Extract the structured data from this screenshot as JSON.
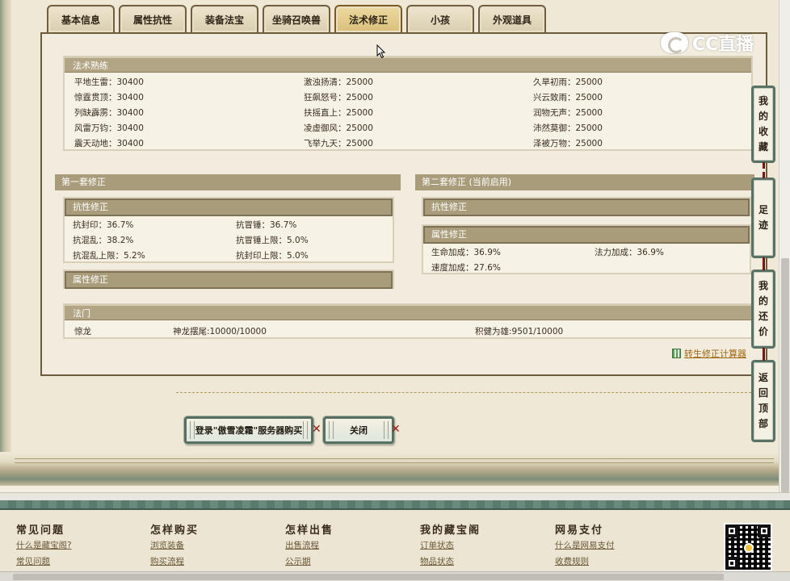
{
  "tabs": [
    {
      "label": "基本信息",
      "active": false
    },
    {
      "label": "属性抗性",
      "active": false
    },
    {
      "label": "装备法宝",
      "active": false
    },
    {
      "label": "坐骑召唤兽",
      "active": false
    },
    {
      "label": "法术修正",
      "active": true
    },
    {
      "label": "小孩",
      "active": false
    },
    {
      "label": "外观道具",
      "active": false
    }
  ],
  "skills": {
    "title": "法术熟练",
    "rows": [
      [
        "平地生雷：30400",
        "激浊扬清：25000",
        "久旱初雨：25000"
      ],
      [
        "惊霆贯顶：30400",
        "狂飙怒号：25000",
        "兴云致雨：25000"
      ],
      [
        "列缺霹雳：30400",
        "扶摇直上：25000",
        "润物无声：25000"
      ],
      [
        "风雷万钧：30400",
        "凌虚御风：25000",
        "沛然莫御：25000"
      ],
      [
        "震天动地：30400",
        "飞举九天：25000",
        "泽被万物：25000"
      ]
    ]
  },
  "set1": {
    "title": "第一套修正",
    "resist": {
      "title": "抗性修正",
      "rows": [
        [
          "抗封印：36.7%",
          "抗冒锤：36.7%"
        ],
        [
          "抗混乱：38.2%",
          "抗冒锤上限：5.0%"
        ],
        [
          "抗混乱上限：5.2%",
          "抗封印上限：5.0%"
        ]
      ]
    },
    "attr": {
      "title": "属性修正"
    }
  },
  "set2": {
    "title": "第二套修正 (当前启用)",
    "resist": {
      "title": "抗性修正"
    },
    "attr": {
      "title": "属性修正",
      "rows": [
        [
          "生命加成：36.9%",
          "法力加成：36.9%"
        ],
        [
          "速度加成：27.6%",
          ""
        ]
      ]
    }
  },
  "famen": {
    "title": "法门",
    "name": "惊龙",
    "item1": "神龙摆尾:10000/10000",
    "item2": "积健为雄:9501/10000"
  },
  "calc_link": "转生修正计算器",
  "buttons": {
    "login": "登录\"傲雪凌霜\"服务器购买",
    "close": "关闭"
  },
  "side_buttons": {
    "favorites": [
      "我",
      "的",
      "收",
      "藏"
    ],
    "footprint": [
      "足",
      "迹"
    ],
    "bargain": [
      "我",
      "的",
      "还",
      "价"
    ],
    "top": [
      "返",
      "回",
      "顶",
      "部"
    ]
  },
  "watermark": "CC直播",
  "footer": {
    "cols": [
      {
        "head": "常见问题",
        "links": [
          "什么是藏宝阁?",
          "常见问题"
        ]
      },
      {
        "head": "怎样购买",
        "links": [
          "浏览装备",
          "购买流程"
        ]
      },
      {
        "head": "怎样出售",
        "links": [
          "出售流程",
          "公示期"
        ]
      },
      {
        "head": "我的藏宝阁",
        "links": [
          "订单状态",
          "物品状态"
        ]
      },
      {
        "head": "网易支付",
        "links": [
          "什么是网易支付",
          "收费规则"
        ]
      }
    ]
  }
}
